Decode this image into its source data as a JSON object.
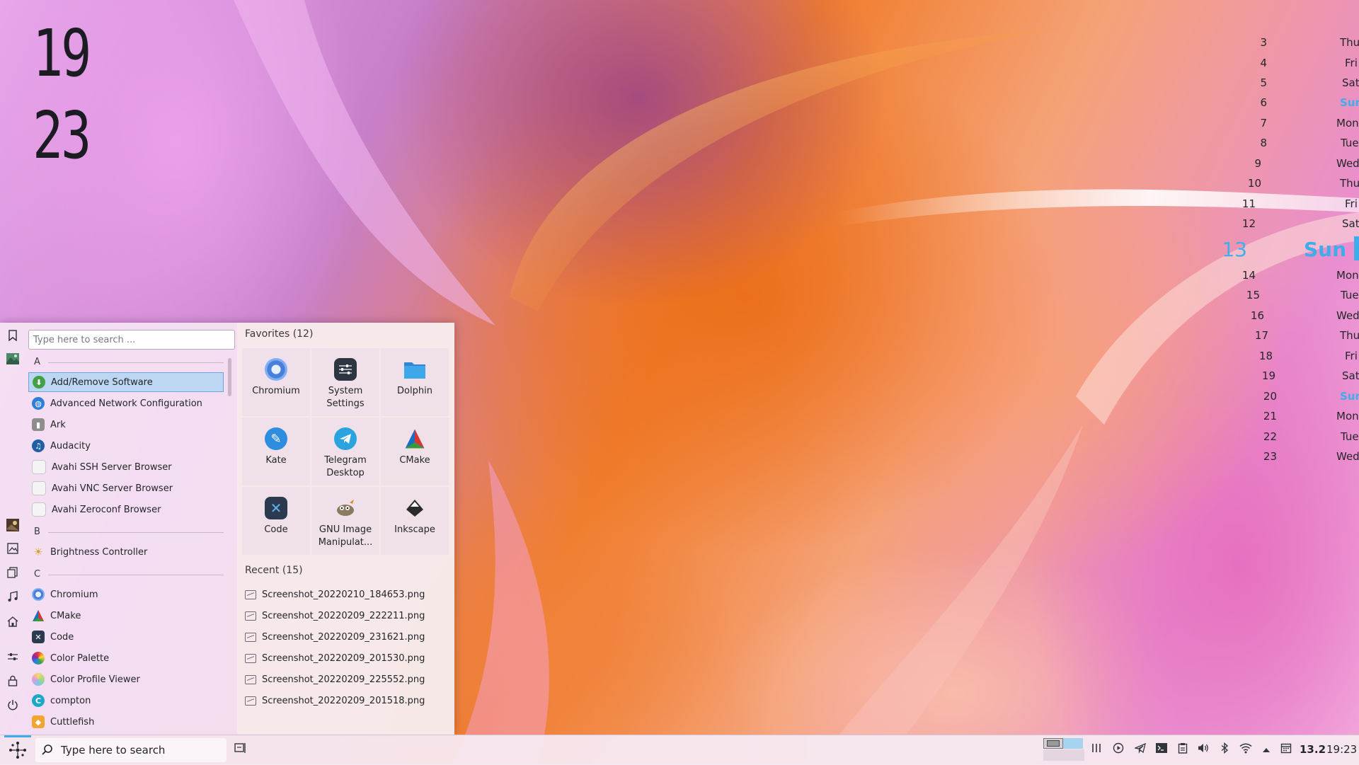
{
  "desktop": {
    "clock_hour": "19",
    "clock_minute": "23"
  },
  "calendar": {
    "rows": [
      {
        "day": "3",
        "weekday": "Thu"
      },
      {
        "day": "4",
        "weekday": "Fri"
      },
      {
        "day": "5",
        "weekday": "Sat"
      },
      {
        "day": "6",
        "weekday": "Sun"
      },
      {
        "day": "7",
        "weekday": "Mon"
      },
      {
        "day": "8",
        "weekday": "Tue"
      },
      {
        "day": "9",
        "weekday": "Wed"
      },
      {
        "day": "10",
        "weekday": "Thu"
      },
      {
        "day": "11",
        "weekday": "Fri"
      },
      {
        "day": "12",
        "weekday": "Sat"
      },
      {
        "day": "13",
        "weekday": "Sun"
      },
      {
        "day": "14",
        "weekday": "Mon"
      },
      {
        "day": "15",
        "weekday": "Tue"
      },
      {
        "day": "16",
        "weekday": "Wed"
      },
      {
        "day": "17",
        "weekday": "Thu"
      },
      {
        "day": "18",
        "weekday": "Fri"
      },
      {
        "day": "19",
        "weekday": "Sat"
      },
      {
        "day": "20",
        "weekday": "Sun"
      },
      {
        "day": "21",
        "weekday": "Mon"
      },
      {
        "day": "22",
        "weekday": "Tue"
      },
      {
        "day": "23",
        "weekday": "Wed"
      }
    ],
    "accent_color": "#3daee9"
  },
  "launcher": {
    "search_placeholder": "Type here to search ...",
    "sections": {
      "a": "A",
      "b": "B",
      "c": "C"
    },
    "apps": {
      "add_remove": "Add/Remove Software",
      "network": "Advanced Network Configuration",
      "ark": "Ark",
      "audacity": "Audacity",
      "avahi_ssh": "Avahi SSH Server Browser",
      "avahi_vnc": "Avahi VNC Server Browser",
      "avahi_zeroconf": "Avahi Zeroconf Browser",
      "brightness": "Brightness Controller",
      "chromium": "Chromium",
      "cmake": "CMake",
      "code": "Code",
      "color_palette": "Color Palette",
      "color_profile": "Color Profile Viewer",
      "compton": "compton",
      "cuttlefish": "Cuttlefish"
    },
    "favorites_heading": "Favorites (12)",
    "favorites": {
      "chromium": "Chromium",
      "system_settings": "System Settings",
      "dolphin": "Dolphin",
      "kate": "Kate",
      "telegram": "Telegram Desktop",
      "cmake": "CMake",
      "code": "Code",
      "gimp": "GNU Image Manipulat...",
      "inkscape": "Inkscape"
    },
    "recent_heading": "Recent (15)",
    "recent": {
      "r1": "Screenshot_20220210_184653.png",
      "r2": "Screenshot_20220209_222211.png",
      "r3": "Screenshot_20220209_231621.png",
      "r4": "Screenshot_20220209_201530.png",
      "r5": "Screenshot_20220209_225552.png",
      "r6": "Screenshot_20220209_201518.png"
    }
  },
  "taskbar": {
    "search_placeholder": "Type here to search",
    "temperature": "13.2",
    "clock": "19:23"
  }
}
